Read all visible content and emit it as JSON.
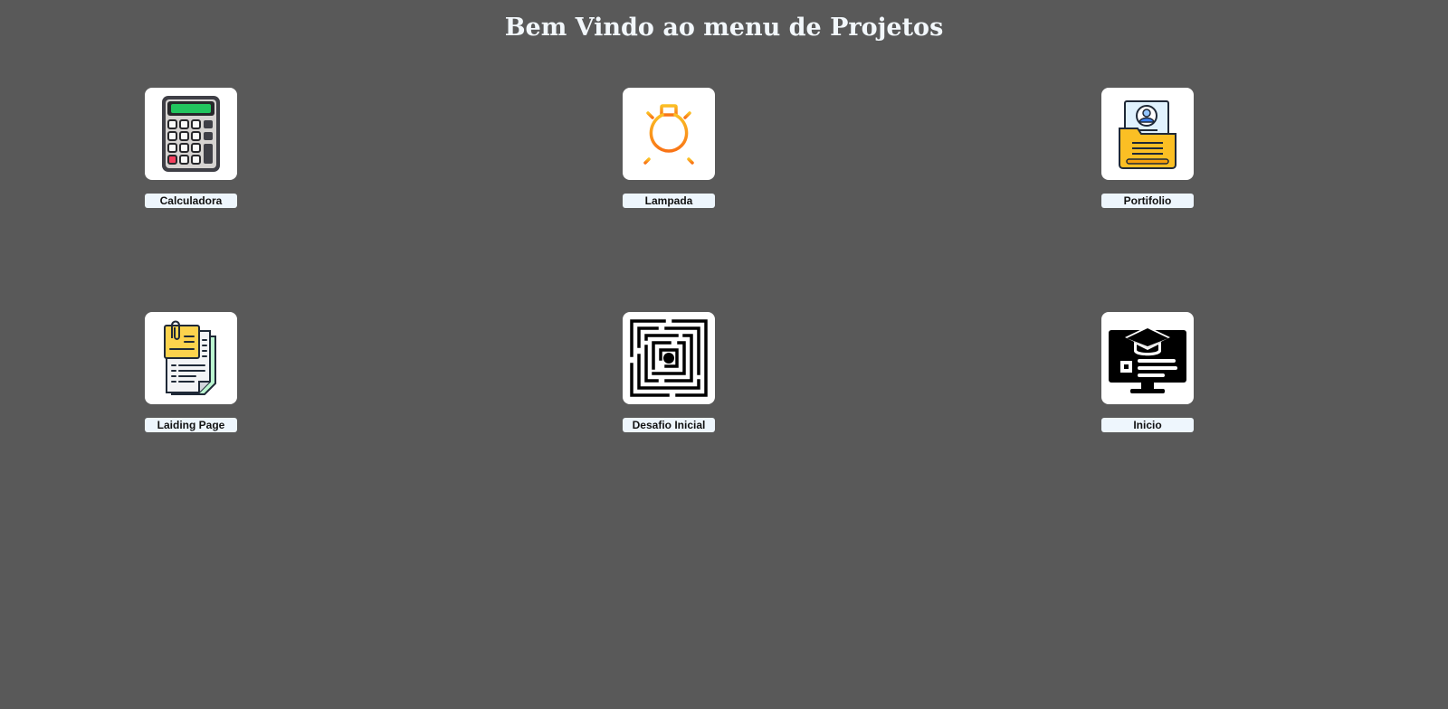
{
  "page": {
    "title": "Bem Vindo ao menu de Projetos",
    "background": "#595959",
    "title_color": "#f2f7fb"
  },
  "projects": [
    {
      "label": "Calculadora",
      "icon": "calculator-icon"
    },
    {
      "label": "Lampada",
      "icon": "lightbulb-icon"
    },
    {
      "label": "Portifolio",
      "icon": "portfolio-folder-icon"
    },
    {
      "label": "Laiding Page",
      "icon": "documents-icon"
    },
    {
      "label": "Desafio Inicial",
      "icon": "maze-icon"
    },
    {
      "label": "Inicio",
      "icon": "graduation-monitor-icon"
    }
  ],
  "colors": {
    "tile": "#ffffff",
    "label_background": "#eef6fd",
    "calculator_display": "#22c55e",
    "bulb_orange": "#f7931e",
    "folder_yellow": "#fbbf24"
  }
}
